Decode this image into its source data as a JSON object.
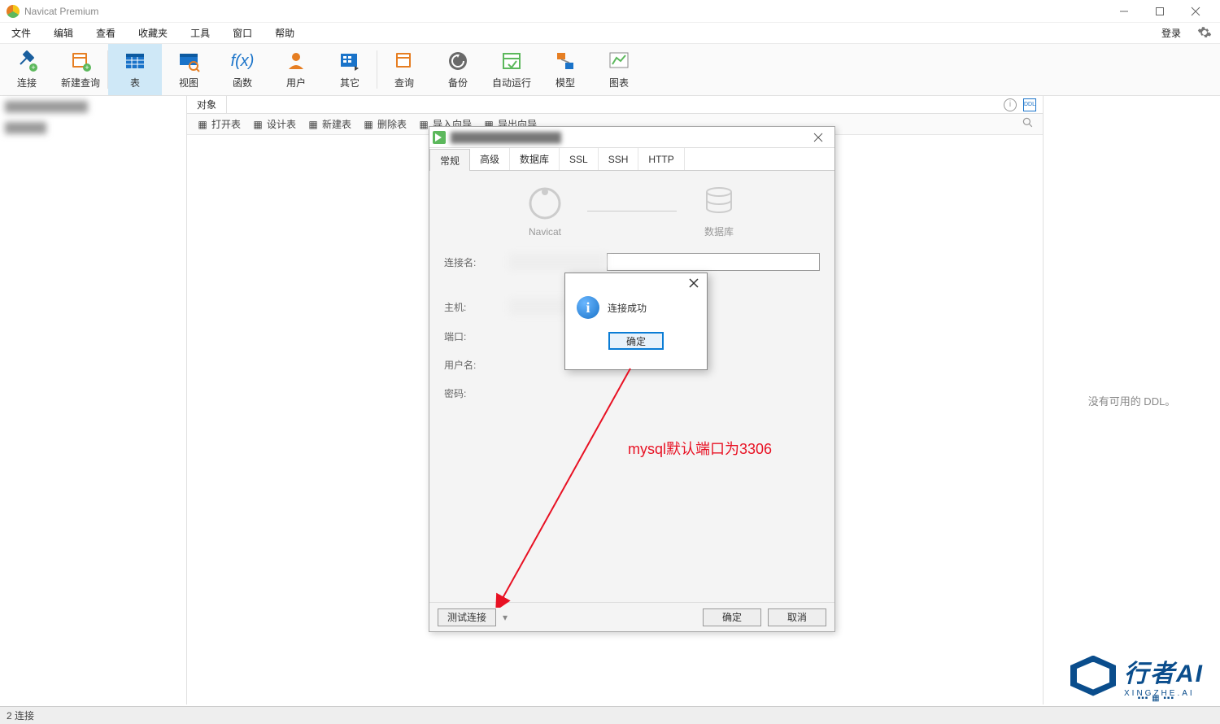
{
  "titlebar": {
    "title": "Navicat Premium"
  },
  "menubar": {
    "items": [
      "文件",
      "编辑",
      "查看",
      "收藏夹",
      "工具",
      "窗口",
      "帮助"
    ],
    "login": "登录"
  },
  "toolbar": {
    "items": [
      {
        "label": "连接",
        "icon": "plug",
        "color": "#1a73c9"
      },
      {
        "label": "新建查询",
        "icon": "newquery",
        "color": "#e67e22"
      },
      {
        "label": "表",
        "icon": "table",
        "color": "#1a73c9",
        "active": true
      },
      {
        "label": "视图",
        "icon": "view",
        "color": "#1a73c9"
      },
      {
        "label": "函数",
        "icon": "fx",
        "color": "#1a73c9"
      },
      {
        "label": "用户",
        "icon": "user",
        "color": "#e67e22"
      },
      {
        "label": "其它",
        "icon": "other",
        "color": "#1a73c9"
      },
      {
        "label": "查询",
        "icon": "query",
        "color": "#e67e22"
      },
      {
        "label": "备份",
        "icon": "backup",
        "color": "#5a5a5a"
      },
      {
        "label": "自动运行",
        "icon": "auto",
        "color": "#5cb85c"
      },
      {
        "label": "模型",
        "icon": "model",
        "color": "#e67e22"
      },
      {
        "label": "图表",
        "icon": "chart",
        "color": "#5cb85c"
      }
    ]
  },
  "objbar": {
    "label": "对象"
  },
  "tabletoolbar": {
    "items": [
      "打开表",
      "设计表",
      "新建表",
      "删除表",
      "导入向导",
      "导出向导"
    ]
  },
  "rightpanel": {
    "empty": "没有可用的 DDL。"
  },
  "dialog": {
    "tabs": [
      "常规",
      "高级",
      "数据库",
      "SSL",
      "SSH",
      "HTTP"
    ],
    "icon_left": "Navicat",
    "icon_right": "数据库",
    "fields": {
      "name": "连接名:",
      "host": "主机:",
      "port": "端口:",
      "user": "用户名:",
      "pass": "密码:"
    },
    "testbtn": "测试连接",
    "ok": "确定",
    "cancel": "取消"
  },
  "msgbox": {
    "text": "连接成功",
    "ok": "确定"
  },
  "annotation": {
    "text": "mysql默认端口为3306"
  },
  "statusbar": {
    "text": "2 连接"
  },
  "watermark": {
    "main": "行者AI",
    "sub": "XINGZHE.AI"
  }
}
